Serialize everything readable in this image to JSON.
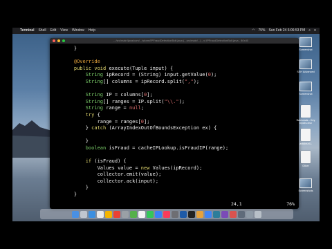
{
  "menubar": {
    "app": "Terminal",
    "items": [
      "Shell",
      "Edit",
      "View",
      "Window",
      "Help"
    ],
    "battery": "75%",
    "clock": "Sun Feb 24  6:06:53 PM"
  },
  "terminal": {
    "title": "..../src/main/java/com/.../storm/IPFraudDetectionBolt.java  (...src/main/...)  - vi IPFraudDetectionBolt.java - 80x40"
  },
  "code": {
    "l1": "    }",
    "l2": "",
    "l3a": "    ",
    "l3ann": "@Override",
    "l4a": "    ",
    "l4kw1": "public",
    "l4s1": " ",
    "l4kw2": "void",
    "l4s2": " execute(Tuple input) {",
    "l5a": "        ",
    "l5ty": "String",
    "l5s1": " ipRecord = (String) input.getValue(",
    "l5num": "0",
    "l5s2": ");",
    "l6a": "        ",
    "l6ty": "String",
    "l6s1": "[] columns = ipRecord.split(",
    "l6str": "\",\"",
    "l6s2": ");",
    "l8a": "        ",
    "l8ty": "String",
    "l8s1": " IP = columns[",
    "l8num": "0",
    "l8s2": "];",
    "l9a": "        ",
    "l9ty": "String",
    "l9s1": "[] ranges = IP.split(",
    "l9str": "\"\\\\.\"",
    "l9s2": ");",
    "l10a": "        ",
    "l10ty": "String",
    "l10s1": " range = ",
    "l10kw": "null",
    "l10s2": ";",
    "l11a": "        ",
    "l11kw": "try",
    "l11s": " {",
    "l12s1": "            range = ranges[",
    "l12num": "0",
    "l12s2": "];",
    "l13a": "        } ",
    "l13kw": "catch",
    "l13s": " (ArrayIndexOutOfBoundsException ex) {",
    "l15": "        }",
    "l16a": "        ",
    "l16ty": "boolean",
    "l16s": " isFraud = cacheIPLookup.isFraudIP(range);",
    "l18a": "        ",
    "l18kw": "if",
    "l18s": " (isFraud) {",
    "l19a": "            Values value = ",
    "l19kw": "new",
    "l19s": " Values(ipRecord);",
    "l20": "            collector.emit(value);",
    "l21": "            collector.ack(input);",
    "l22": "        }",
    "l23": "    }"
  },
  "status": {
    "position": "24,1",
    "percent": "76%"
  },
  "desktop_icons": [
    {
      "label": "Screenshot"
    },
    {
      "label": "SSH Advanced"
    },
    {
      "label": "Screenshot"
    },
    {
      "label": "Subheads - Key Inputs.xlsx"
    },
    {
      "label": "articleurl.1"
    },
    {
      "label": "Other"
    },
    {
      "label": "Screenshots"
    }
  ],
  "colors": {
    "annotation": "#e3a23b",
    "keyword": "#e0d66f",
    "type": "#7ed36c",
    "literal": "#e07070",
    "text": "#f2f2f2"
  }
}
